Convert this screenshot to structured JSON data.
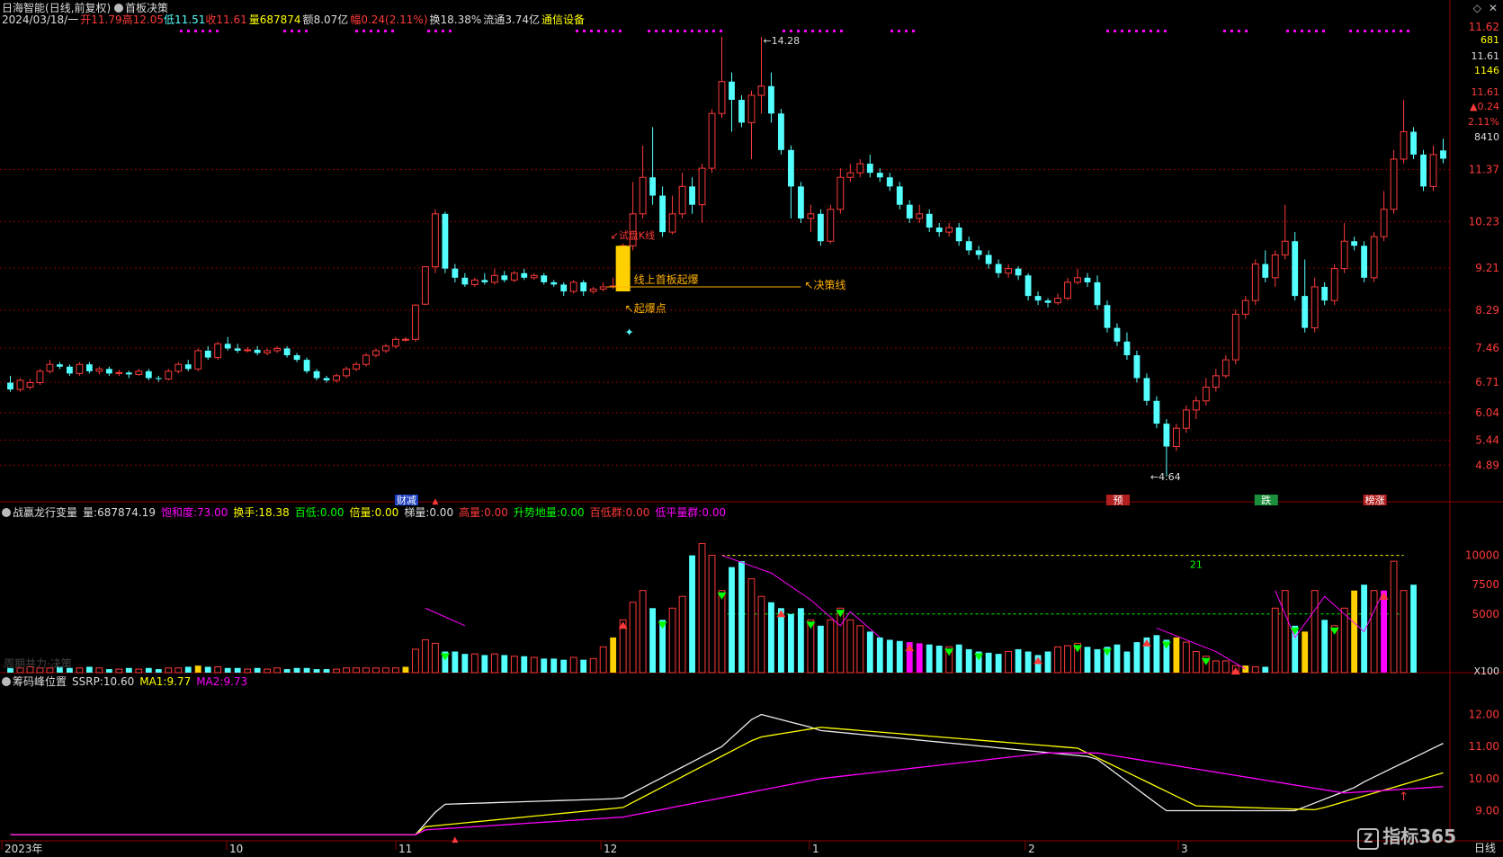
{
  "header": {
    "stock_name": "日海智能",
    "period_info": "(日线,前复权)",
    "indicator_name": "首板决策"
  },
  "quote_line": {
    "date": "2024/03/18/一",
    "open_label": "开",
    "open": "11.79",
    "high_label": "高",
    "high": "12.05",
    "low_label": "低",
    "low": "11.51",
    "close_label": "收",
    "close": "11.61",
    "volume_label": "量",
    "volume": "687874",
    "amount_label": "额",
    "amount": "8.07亿",
    "change_label": "幅",
    "change": "0.24(2.11%)",
    "turnover_label": "换",
    "turnover": "18.38%",
    "float_label": "流通",
    "float_value": "3.74亿",
    "industry": "通信设备"
  },
  "main_axis": {
    "ticks": [
      "11.62",
      "11.37",
      "10.23",
      "9.21",
      "8.29",
      "7.46",
      "6.71",
      "6.04",
      "5.44",
      "4.89"
    ],
    "right_panel": {
      "price": "11.62",
      "vol_a": "681",
      "price2": "11.61",
      "vol_b": "1146",
      "price3": "11.61",
      "chg": "▲0.24",
      "pct": "2.11%",
      "vol_c": "8410"
    }
  },
  "annotations": {
    "high_price": "14.28",
    "low_price": "4.64",
    "trial_k": "试盘K线",
    "first_board": "线上首板起爆",
    "decision_line": "决策线",
    "explosion_point": "起爆点",
    "marker_caicheng": "财减",
    "marker_yu": "预",
    "marker_die": "跌",
    "marker_bangzhang": "榜涨"
  },
  "panel2": {
    "name": "战赢龙行变量",
    "vol_label": "量:",
    "vol_value": "687874.19",
    "saturation_label": "饱和度:",
    "saturation": "73.00",
    "hand_label": "换手:",
    "hand": "18.38",
    "bai_di_label": "百低:",
    "bai_di": "0.00",
    "bei_liang_label": "倍量:",
    "bei_liang": "0.00",
    "ti_liang_label": "梯量:",
    "ti_liang": "0.00",
    "gao_liang_label": "高量:",
    "gao_liang": "0.00",
    "shengshi_label": "升势地量:",
    "shengshi": "0.00",
    "bai_di_qun_label": "百低群:",
    "bai_di_qun": "0.00",
    "di_ping_label": "低平量群:",
    "di_ping": "0.00",
    "ticks": [
      "10000",
      "7500",
      "5000"
    ],
    "scale": "X100",
    "count_21": "21",
    "watermark": "周期共力·决策"
  },
  "panel3": {
    "name": "筹码峰位置",
    "ssrp_label": "SSRP:",
    "ssrp": "10.60",
    "ma1_label": "MA1:",
    "ma1": "9.77",
    "ma2_label": "MA2:",
    "ma2": "9.73",
    "ticks": [
      "12.00",
      "11.00",
      "10.00",
      "9.00"
    ]
  },
  "x_axis": {
    "labels": [
      "2023年",
      "10",
      "11",
      "12",
      "1",
      "2",
      "3"
    ]
  },
  "footer": {
    "logo": "指标365",
    "period": "日线"
  },
  "colors": {
    "up": "#ff3a3a",
    "down": "#54ffff",
    "grid": "#8b0000",
    "yellow": "#ffff00",
    "magenta": "#ff00ff",
    "green": "#00ff00",
    "orange": "#ffb000"
  },
  "chart_data": {
    "type": "candlestick",
    "price_range": [
      4.6,
      14.3
    ],
    "candles": [
      [
        6.7,
        6.55,
        6.85,
        6.5
      ],
      [
        6.55,
        6.75,
        6.8,
        6.5
      ],
      [
        6.6,
        6.7,
        6.78,
        6.55
      ],
      [
        6.7,
        6.95,
        7.0,
        6.65
      ],
      [
        6.95,
        7.1,
        7.2,
        6.9
      ],
      [
        7.1,
        7.05,
        7.15,
        7.0
      ],
      [
        7.05,
        6.9,
        7.1,
        6.85
      ],
      [
        6.9,
        7.1,
        7.15,
        6.85
      ],
      [
        7.1,
        6.95,
        7.15,
        6.9
      ],
      [
        6.95,
        7.0,
        7.05,
        6.88
      ],
      [
        7.0,
        6.9,
        7.05,
        6.85
      ],
      [
        6.9,
        6.92,
        6.98,
        6.85
      ],
      [
        6.92,
        6.88,
        6.96,
        6.8
      ],
      [
        6.88,
        6.95,
        7.0,
        6.85
      ],
      [
        6.95,
        6.8,
        7.0,
        6.75
      ],
      [
        6.8,
        6.78,
        6.85,
        6.72
      ],
      [
        6.78,
        6.95,
        7.0,
        6.75
      ],
      [
        6.95,
        7.1,
        7.15,
        6.9
      ],
      [
        7.1,
        7.0,
        7.2,
        6.95
      ],
      [
        7.0,
        7.4,
        7.45,
        6.95
      ],
      [
        7.4,
        7.25,
        7.5,
        7.2
      ],
      [
        7.25,
        7.55,
        7.6,
        7.2
      ],
      [
        7.55,
        7.45,
        7.7,
        7.4
      ],
      [
        7.45,
        7.4,
        7.55,
        7.35
      ],
      [
        7.4,
        7.42,
        7.48,
        7.36
      ],
      [
        7.42,
        7.35,
        7.5,
        7.3
      ],
      [
        7.35,
        7.4,
        7.45,
        7.3
      ],
      [
        7.4,
        7.45,
        7.5,
        7.35
      ],
      [
        7.45,
        7.3,
        7.5,
        7.25
      ],
      [
        7.3,
        7.2,
        7.35,
        7.15
      ],
      [
        7.2,
        6.95,
        7.25,
        6.9
      ],
      [
        6.95,
        6.8,
        7.0,
        6.75
      ],
      [
        6.8,
        6.75,
        6.85,
        6.7
      ],
      [
        6.75,
        6.85,
        6.9,
        6.7
      ],
      [
        6.85,
        7.0,
        7.05,
        6.8
      ],
      [
        7.0,
        7.1,
        7.15,
        6.95
      ],
      [
        7.1,
        7.3,
        7.35,
        7.05
      ],
      [
        7.3,
        7.4,
        7.45,
        7.25
      ],
      [
        7.4,
        7.5,
        7.55,
        7.35
      ],
      [
        7.5,
        7.65,
        7.7,
        7.45
      ],
      [
        7.65,
        7.65,
        7.7,
        7.6
      ],
      [
        7.65,
        8.4,
        8.42,
        7.6
      ],
      [
        8.42,
        9.24,
        9.25,
        8.4
      ],
      [
        9.24,
        10.4,
        10.5,
        9.1
      ],
      [
        10.4,
        9.2,
        10.45,
        9.1
      ],
      [
        9.2,
        9.0,
        9.3,
        8.9
      ],
      [
        9.0,
        8.85,
        9.1,
        8.8
      ],
      [
        8.85,
        8.95,
        9.0,
        8.8
      ],
      [
        8.95,
        8.9,
        9.1,
        8.85
      ],
      [
        8.9,
        9.05,
        9.2,
        8.85
      ],
      [
        9.05,
        8.95,
        9.15,
        8.9
      ],
      [
        8.95,
        9.1,
        9.15,
        8.9
      ],
      [
        9.1,
        9.0,
        9.2,
        8.95
      ],
      [
        9.0,
        9.05,
        9.1,
        8.95
      ],
      [
        9.05,
        8.9,
        9.1,
        8.85
      ],
      [
        8.9,
        8.85,
        8.95,
        8.8
      ],
      [
        8.85,
        8.7,
        8.9,
        8.6
      ],
      [
        8.7,
        8.9,
        8.95,
        8.65
      ],
      [
        8.9,
        8.7,
        8.95,
        8.6
      ],
      [
        8.7,
        8.75,
        8.8,
        8.65
      ],
      [
        8.75,
        8.8,
        8.9,
        8.7
      ],
      [
        8.8,
        8.82,
        9.0,
        8.75
      ],
      [
        8.82,
        9.7,
        9.75,
        8.75
      ],
      [
        9.7,
        10.4,
        11.1,
        9.6
      ],
      [
        10.4,
        11.2,
        11.9,
        10.3
      ],
      [
        11.2,
        10.8,
        12.3,
        10.6
      ],
      [
        10.8,
        10.0,
        11.0,
        9.9
      ],
      [
        10.0,
        10.4,
        10.8,
        9.95
      ],
      [
        10.4,
        11.0,
        11.3,
        10.3
      ],
      [
        11.0,
        10.6,
        11.2,
        10.4
      ],
      [
        10.6,
        11.4,
        11.5,
        10.2
      ],
      [
        11.4,
        12.6,
        12.7,
        11.3
      ],
      [
        12.6,
        13.3,
        14.28,
        12.5
      ],
      [
        13.3,
        12.9,
        13.5,
        12.2
      ],
      [
        12.9,
        12.4,
        13.0,
        12.3
      ],
      [
        12.4,
        13.0,
        13.1,
        11.6
      ],
      [
        13.0,
        13.2,
        14.28,
        12.6
      ],
      [
        13.2,
        12.6,
        13.5,
        12.4
      ],
      [
        12.6,
        11.8,
        12.7,
        11.7
      ],
      [
        11.8,
        11.0,
        11.9,
        10.3
      ],
      [
        11.0,
        10.3,
        11.1,
        10.2
      ],
      [
        10.3,
        10.4,
        10.6,
        10.0
      ],
      [
        10.4,
        9.8,
        10.5,
        9.7
      ],
      [
        9.8,
        10.5,
        10.6,
        9.75
      ],
      [
        10.5,
        11.2,
        11.4,
        10.4
      ],
      [
        11.2,
        11.3,
        11.5,
        11.1
      ],
      [
        11.3,
        11.5,
        11.6,
        11.2
      ],
      [
        11.5,
        11.3,
        11.7,
        11.2
      ],
      [
        11.3,
        11.2,
        11.4,
        11.1
      ],
      [
        11.2,
        11.0,
        11.3,
        10.9
      ],
      [
        11.0,
        10.6,
        11.1,
        10.5
      ],
      [
        10.6,
        10.3,
        10.7,
        10.2
      ],
      [
        10.3,
        10.4,
        10.6,
        10.2
      ],
      [
        10.4,
        10.1,
        10.5,
        10.0
      ],
      [
        10.1,
        10.0,
        10.2,
        9.9
      ],
      [
        10.0,
        10.1,
        10.2,
        9.9
      ],
      [
        10.1,
        9.8,
        10.2,
        9.7
      ],
      [
        9.8,
        9.6,
        9.9,
        9.5
      ],
      [
        9.6,
        9.5,
        9.7,
        9.4
      ],
      [
        9.5,
        9.3,
        9.6,
        9.2
      ],
      [
        9.3,
        9.1,
        9.4,
        9.0
      ],
      [
        9.1,
        9.2,
        9.3,
        9.0
      ],
      [
        9.2,
        9.05,
        9.25,
        8.95
      ],
      [
        9.05,
        8.6,
        9.1,
        8.5
      ],
      [
        8.6,
        8.5,
        8.7,
        8.4
      ],
      [
        8.5,
        8.45,
        8.55,
        8.35
      ],
      [
        8.45,
        8.55,
        8.65,
        8.4
      ],
      [
        8.55,
        8.9,
        9.0,
        8.5
      ],
      [
        8.9,
        9.0,
        9.2,
        8.85
      ],
      [
        9.0,
        8.9,
        9.1,
        8.8
      ],
      [
        8.9,
        8.4,
        9.05,
        8.3
      ],
      [
        8.4,
        7.9,
        8.5,
        7.8
      ],
      [
        7.9,
        7.6,
        8.0,
        7.5
      ],
      [
        7.6,
        7.3,
        7.8,
        7.2
      ],
      [
        7.3,
        6.8,
        7.4,
        6.7
      ],
      [
        6.8,
        6.3,
        6.9,
        6.2
      ],
      [
        6.3,
        5.8,
        6.4,
        5.7
      ],
      [
        5.8,
        5.3,
        5.9,
        4.64
      ],
      [
        5.3,
        5.7,
        5.8,
        5.2
      ],
      [
        5.7,
        6.1,
        6.2,
        5.6
      ],
      [
        6.1,
        6.3,
        6.4,
        5.9
      ],
      [
        6.3,
        6.6,
        6.8,
        6.2
      ],
      [
        6.6,
        6.85,
        7.0,
        6.5
      ],
      [
        6.85,
        7.2,
        7.3,
        6.8
      ],
      [
        7.2,
        8.2,
        8.3,
        7.1
      ],
      [
        8.2,
        8.5,
        8.6,
        8.1
      ],
      [
        8.5,
        9.3,
        9.4,
        8.4
      ],
      [
        9.3,
        9.0,
        9.6,
        8.9
      ],
      [
        9.0,
        9.5,
        9.6,
        8.8
      ],
      [
        9.5,
        9.8,
        10.6,
        9.4
      ],
      [
        9.8,
        8.6,
        10.0,
        8.5
      ],
      [
        8.6,
        7.9,
        9.4,
        7.8
      ],
      [
        7.9,
        8.8,
        9.0,
        7.8
      ],
      [
        8.8,
        8.5,
        8.9,
        8.4
      ],
      [
        8.5,
        9.2,
        9.3,
        8.4
      ],
      [
        9.2,
        9.8,
        10.2,
        9.1
      ],
      [
        9.8,
        9.7,
        9.9,
        9.6
      ],
      [
        9.7,
        9.0,
        9.8,
        8.9
      ],
      [
        9.0,
        9.9,
        10.0,
        8.9
      ],
      [
        9.9,
        10.5,
        10.9,
        9.8
      ],
      [
        10.5,
        11.6,
        11.8,
        10.4
      ],
      [
        11.6,
        12.2,
        12.9,
        11.5
      ],
      [
        12.2,
        11.7,
        12.3,
        11.6
      ],
      [
        11.7,
        11.0,
        11.8,
        10.9
      ],
      [
        11.0,
        11.7,
        11.9,
        10.9
      ],
      [
        11.79,
        11.61,
        12.05,
        11.51
      ]
    ],
    "volume_rel": [
      4,
      4,
      5,
      4,
      4,
      5,
      4,
      4,
      5,
      4,
      3,
      3,
      4,
      3,
      4,
      3,
      4,
      4,
      5,
      6,
      5,
      5,
      4,
      4,
      3,
      4,
      3,
      4,
      3,
      4,
      4,
      3,
      3,
      3,
      4,
      4,
      4,
      4,
      4,
      4,
      5,
      20,
      28,
      25,
      18,
      18,
      16,
      16,
      15,
      16,
      15,
      14,
      14,
      13,
      12,
      12,
      11,
      13,
      11,
      12,
      22,
      30,
      45,
      60,
      70,
      55,
      45,
      55,
      65,
      100,
      110,
      100,
      70,
      90,
      95,
      80,
      65,
      60,
      55,
      50,
      55,
      45,
      40,
      45,
      55,
      45,
      40,
      35,
      30,
      28,
      27,
      26,
      25,
      24,
      23,
      22,
      24,
      20,
      18,
      17,
      16,
      18,
      20,
      18,
      15,
      18,
      22,
      23,
      25,
      22,
      20,
      22,
      24,
      18,
      26,
      30,
      32,
      28,
      30,
      26,
      18,
      14,
      10,
      10,
      6,
      6,
      5,
      5,
      55,
      70,
      40,
      35,
      70,
      45,
      40,
      55,
      70,
      75,
      70,
      70,
      95,
      70,
      75
    ]
  }
}
